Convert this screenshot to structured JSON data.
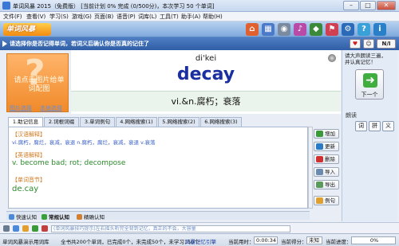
{
  "window": {
    "title": "单词风暴 2015（免费版） [当前计划 0% 完成 (0/500分)，本次学习 50 个单词]",
    "min": "–",
    "max": "□",
    "close": "✕"
  },
  "menu": [
    "文件(F)",
    "查看(V)",
    "学习(S)",
    "游戏(G)",
    "页面(B)",
    "语音(P)",
    "词库(L)",
    "工具(T)",
    "助手(A)",
    "帮助(H)"
  ],
  "toolbar": {
    "logo": "单词风暴"
  },
  "hint": {
    "text": "请选择你是否记得单词，若词义后确认你是否真的记住了",
    "n_label": "N/I"
  },
  "image_panel": {
    "placeholder": "请点击图片给单词配图",
    "link_select": "图片选择",
    "link_local": "本地选择"
  },
  "word": {
    "phonetic": "di'kei",
    "headword": "decay",
    "definition": "vi.&n.腐朽；衰落"
  },
  "right_panel": {
    "tip": "请大声朗读三遍，并认真记忆！",
    "next": "下一个",
    "read_label": "朗读",
    "read_buttons": [
      "词",
      "拼",
      "义"
    ]
  },
  "tabs": [
    "1.助记信息",
    "2.词根词缀",
    "3.单词例句",
    "4.网络搜索(1)",
    "5.网络搜索(2)",
    "6.网络搜索(3)"
  ],
  "memo": {
    "cn_head": "【汉语解释】",
    "cn_body": "vi.腐朽，腐烂，衰减，衰退 n.腐朽，腐烂，衰减，衰退 v.衰落",
    "en_head": "【英语解释】",
    "en_body": "v. become bad; rot; decompose",
    "syl_head": "【单词音节】",
    "syl_body": "de.cay"
  },
  "side_buttons": [
    "增加",
    "更新",
    "删除",
    "导入",
    "导出",
    "例句"
  ],
  "mode_tabs": [
    "快速认知",
    "常规认知",
    "精确认知"
  ],
  "tipbar": {
    "text": "(单词风暴技巧提示)左右摇头听完全背到记忆，真正的不会，大容量"
  },
  "status": {
    "app": "单词风暴演示用词库",
    "total": "全书共200个单词，已完成0个，未完成50个，未学习150个",
    "engine": "风暴记忆引擎",
    "time_label": "当前用时：",
    "time_value": "0:00:34",
    "score_label": "当前得分：",
    "score_value": "未知",
    "progress_label": "当前进度：",
    "progress_value": "0%"
  },
  "colors": {
    "accent": "#2f5ea6",
    "headword": "#1a2fa0",
    "section": "#d07a20",
    "body_blue": "#3b62c4",
    "body_green": "#2a8a2a",
    "next_green": "#3fae3f"
  }
}
